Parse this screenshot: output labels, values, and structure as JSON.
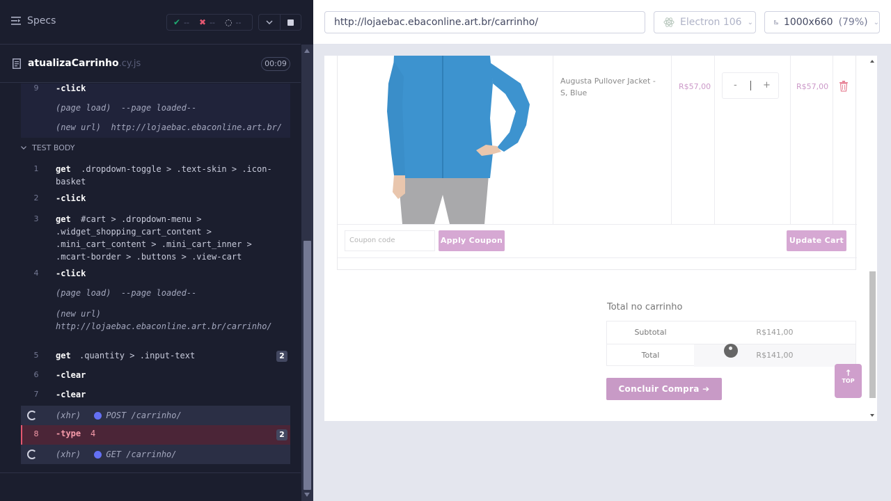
{
  "reporter": {
    "specs_label": "Specs",
    "stats": {
      "passed": "--",
      "failed": "--",
      "pending": "--"
    },
    "file": {
      "name": "atualizaCarrinho",
      "ext": ".cy.js",
      "duration": "00:09"
    },
    "hook_commands": [
      {
        "num": "9",
        "name": "-click"
      },
      {
        "event": "(page load)",
        "message": "--page loaded--"
      },
      {
        "event": "(new url)",
        "message": "http://lojaebac.ebaconline.art.br/"
      }
    ],
    "section_title": "TEST BODY",
    "commands": [
      {
        "num": "1",
        "name": "get",
        "message": ".dropdown-toggle > .text-skin > .icon-basket"
      },
      {
        "num": "2",
        "name": "-click"
      },
      {
        "num": "3",
        "name": "get",
        "message": "#cart > .dropdown-menu > .widget_shopping_cart_content > .mini_cart_content > .mini_cart_inner > .mcart-border > .buttons > .view-cart"
      },
      {
        "num": "4",
        "name": "-click"
      },
      {
        "event": "(page load)",
        "message": "--page loaded--"
      },
      {
        "event": "(new url)",
        "message": "http://lojaebac.ebaconline.art.br/carrinho/"
      },
      {
        "num": "5",
        "name": "get",
        "message": ".quantity > .input-text",
        "badge": "2"
      },
      {
        "num": "6",
        "name": "-clear"
      },
      {
        "num": "7",
        "name": "-clear"
      },
      {
        "event": "(xhr)",
        "message": "POST /carrinho/"
      },
      {
        "num": "8",
        "name": "-type",
        "message": "4",
        "badge": "2"
      },
      {
        "event": "(xhr)",
        "message": "GET /carrinho/"
      }
    ]
  },
  "aut": {
    "url": "http://lojaebac.ebaconline.art.br/carrinho/",
    "browser": "Electron 106",
    "viewport": "1000x660",
    "zoom": "(79%)",
    "cart": {
      "product_name": "Augusta Pullover Jacket - S, Blue",
      "price": "R$57,00",
      "qty_minus": "-",
      "qty_plus": "+",
      "line_total": "R$57,00",
      "coupon_placeholder": "Coupon code",
      "apply_coupon": "Apply Coupon",
      "update_cart": "Update Cart"
    },
    "totals": {
      "title": "Total no carrinho",
      "subtotal_label": "Subtotal",
      "subtotal_value": "R$141,00",
      "total_label": "Total",
      "total_value": "R$141,00",
      "checkout": "Concluir Compra ➔"
    },
    "top_button": "TOP"
  },
  "colors": {
    "reporter_bg": "#1b1e2e",
    "accent_pink": "#d6a8d3",
    "fail_red": "#e45770",
    "pass_green": "#1fa971",
    "xhr_dot": "#6470f3"
  }
}
